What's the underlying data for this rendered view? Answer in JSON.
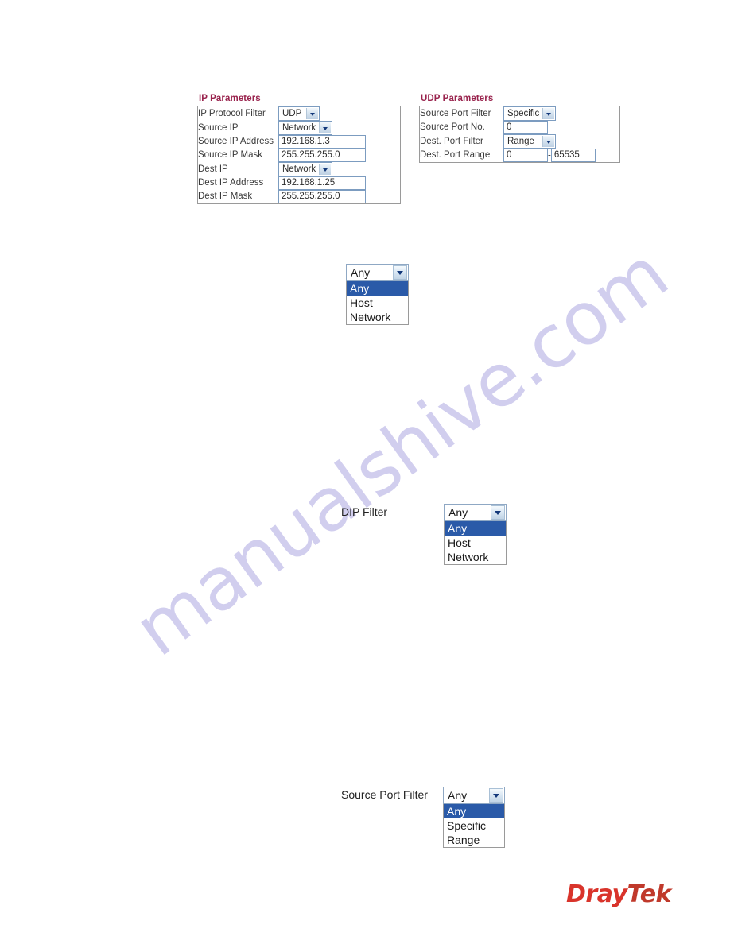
{
  "watermark": {
    "text": "manualshive.com",
    "color": "#c9c6ec"
  },
  "ip_parameters": {
    "title": "IP Parameters",
    "rows": [
      {
        "label": "IP Protocol Filter",
        "control": "select",
        "value": "UDP"
      },
      {
        "label": "Source IP",
        "control": "select",
        "value": "Network"
      },
      {
        "label": "Source IP Address",
        "control": "text",
        "value": "192.168.1.3"
      },
      {
        "label": "Source IP Mask",
        "control": "text",
        "value": "255.255.255.0"
      },
      {
        "label": "Dest IP",
        "control": "select",
        "value": "Network"
      },
      {
        "label": "Dest IP Address",
        "control": "text",
        "value": "192.168.1.25"
      },
      {
        "label": "Dest IP Mask",
        "control": "text",
        "value": "255.255.255.0"
      }
    ]
  },
  "udp_parameters": {
    "title": "UDP Parameters",
    "rows": [
      {
        "label": "Source Port Filter",
        "control": "select",
        "value": "Specific"
      },
      {
        "label": "Source Port No.",
        "control": "text",
        "value": "0"
      },
      {
        "label": "Dest. Port Filter",
        "control": "select",
        "value": "Range"
      },
      {
        "label": "Dest. Port Range",
        "control": "range",
        "value_from": "0",
        "separator": "-",
        "value_to": "65535"
      }
    ]
  },
  "dropdown_sip": {
    "label": "",
    "selected": "Any",
    "options": [
      "Any",
      "Host",
      "Network"
    ],
    "highlighted": "Any"
  },
  "dropdown_dip": {
    "label": "DIP Filter",
    "selected": "Any",
    "options": [
      "Any",
      "Host",
      "Network"
    ],
    "highlighted": "Any"
  },
  "dropdown_source_port": {
    "label": "Source Port Filter",
    "selected": "Any",
    "options": [
      "Any",
      "Specific",
      "Range"
    ],
    "highlighted": "Any"
  },
  "logo": {
    "part1": "Dray",
    "part2": "Tek"
  }
}
